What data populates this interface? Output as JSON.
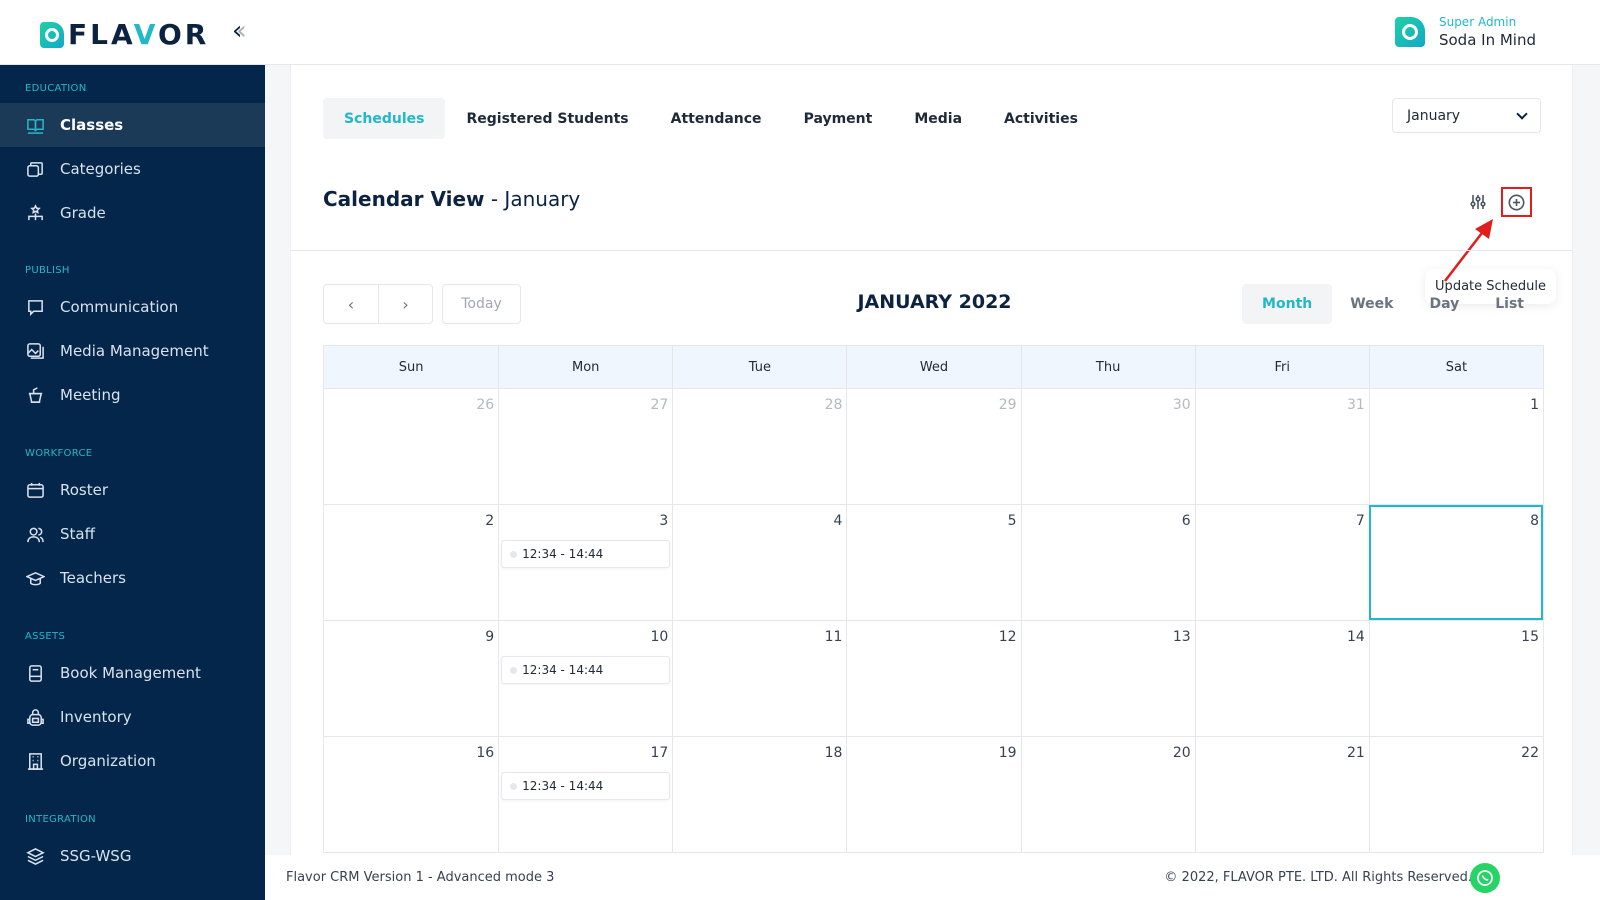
{
  "header": {
    "logo_text_part1": "FLA",
    "logo_text_part2": "V",
    "logo_text_part3": "OR",
    "collapse_icon": "double-chevron-left-icon",
    "user": {
      "role": "Super Admin",
      "name": "Soda In Mind"
    }
  },
  "sidebar": {
    "sections": [
      {
        "title": "EDUCATION",
        "items": [
          {
            "label": "Classes",
            "icon": "book-open-icon",
            "active": true
          },
          {
            "label": "Categories",
            "icon": "stack-icon"
          },
          {
            "label": "Grade",
            "icon": "hierarchy-icon"
          }
        ]
      },
      {
        "title": "PUBLISH",
        "items": [
          {
            "label": "Communication",
            "icon": "message-icon"
          },
          {
            "label": "Media Management",
            "icon": "gallery-icon"
          },
          {
            "label": "Meeting",
            "icon": "podium-icon"
          }
        ]
      },
      {
        "title": "WORKFORCE",
        "items": [
          {
            "label": "Roster",
            "icon": "calendar-icon"
          },
          {
            "label": "Staff",
            "icon": "users-icon"
          },
          {
            "label": "Teachers",
            "icon": "graduation-cap-icon"
          }
        ]
      },
      {
        "title": "ASSETS",
        "items": [
          {
            "label": "Book Management",
            "icon": "book-icon"
          },
          {
            "label": "Inventory",
            "icon": "backpack-icon"
          },
          {
            "label": "Organization",
            "icon": "building-icon"
          }
        ]
      },
      {
        "title": "INTEGRATION",
        "items": [
          {
            "label": "SSG-WSG",
            "icon": "layers-icon"
          }
        ]
      }
    ]
  },
  "main": {
    "tabs": [
      {
        "label": "Schedules",
        "active": true
      },
      {
        "label": "Registered Students"
      },
      {
        "label": "Attendance"
      },
      {
        "label": "Payment"
      },
      {
        "label": "Media"
      },
      {
        "label": "Activities"
      }
    ],
    "month_select": {
      "value": "January"
    },
    "calendar_title": {
      "bold": "Calendar View",
      "rest": " - January"
    },
    "tooltip": "Update Schedule",
    "icons": {
      "filter": "sliders-icon",
      "add": "plus-circle-icon"
    }
  },
  "calendar": {
    "today_label": "Today",
    "month_label": "JANUARY 2022",
    "views": [
      {
        "label": "Month",
        "active": true
      },
      {
        "label": "Week"
      },
      {
        "label": "Day"
      },
      {
        "label": "List"
      }
    ],
    "days_of_week": [
      "Sun",
      "Mon",
      "Tue",
      "Wed",
      "Thu",
      "Fri",
      "Sat"
    ],
    "weeks": [
      [
        {
          "n": "26",
          "other": true
        },
        {
          "n": "27",
          "other": true
        },
        {
          "n": "28",
          "other": true
        },
        {
          "n": "29",
          "other": true
        },
        {
          "n": "30",
          "other": true
        },
        {
          "n": "31",
          "other": true
        },
        {
          "n": "1"
        }
      ],
      [
        {
          "n": "2"
        },
        {
          "n": "3",
          "event": "12:34 - 14:44"
        },
        {
          "n": "4"
        },
        {
          "n": "5"
        },
        {
          "n": "6"
        },
        {
          "n": "7"
        },
        {
          "n": "8",
          "today": true
        }
      ],
      [
        {
          "n": "9"
        },
        {
          "n": "10",
          "event": "12:34 - 14:44"
        },
        {
          "n": "11"
        },
        {
          "n": "12"
        },
        {
          "n": "13"
        },
        {
          "n": "14"
        },
        {
          "n": "15"
        }
      ],
      [
        {
          "n": "16"
        },
        {
          "n": "17",
          "event": "12:34 - 14:44"
        },
        {
          "n": "18"
        },
        {
          "n": "19"
        },
        {
          "n": "20"
        },
        {
          "n": "21"
        },
        {
          "n": "22"
        }
      ]
    ]
  },
  "footer": {
    "left": "Flavor CRM Version 1 - Advanced mode 3",
    "right": "© 2022, FLAVOR PTE. LTD. All Rights Reserved.",
    "whatsapp_icon": "whatsapp-icon"
  },
  "colors": {
    "accent": "#22b8c9",
    "sidebar_bg": "#04264a",
    "highlight_box": "#e11d1d"
  }
}
